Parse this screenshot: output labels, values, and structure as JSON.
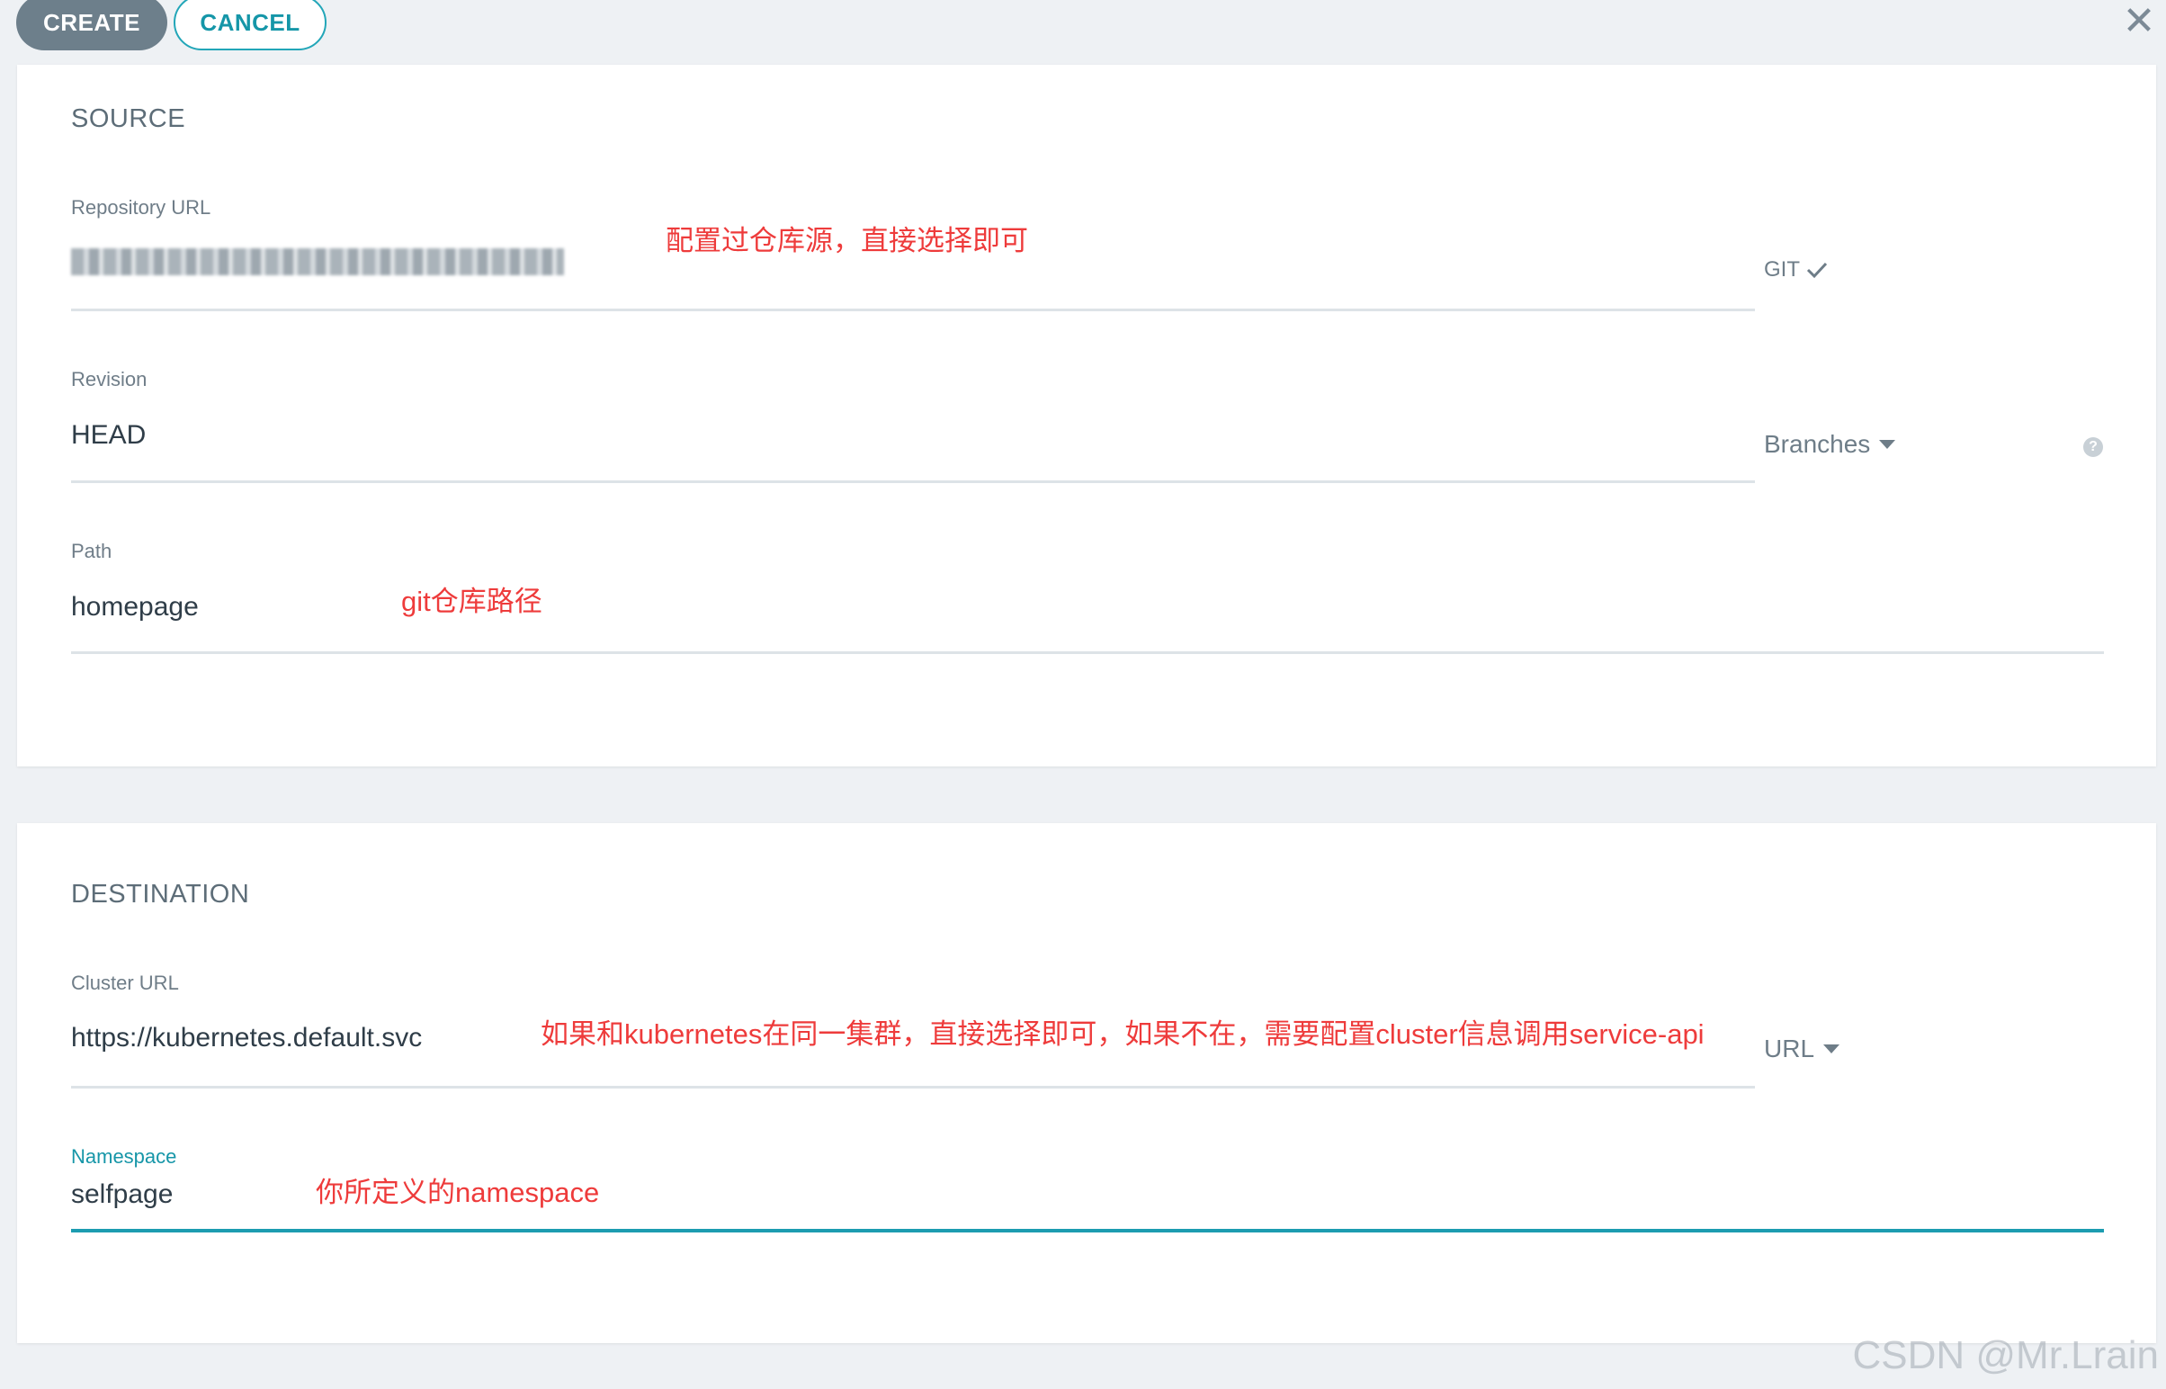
{
  "toolbar": {
    "create_label": "CREATE",
    "cancel_label": "CANCEL"
  },
  "source": {
    "title": "SOURCE",
    "repo_label": "Repository URL",
    "repo_type": "GIT",
    "revision_label": "Revision",
    "revision_value": "HEAD",
    "revision_dropdown": "Branches",
    "path_label": "Path",
    "path_value": "homepage"
  },
  "destination": {
    "title": "DESTINATION",
    "cluster_label": "Cluster URL",
    "cluster_value": "https://kubernetes.default.svc",
    "cluster_dropdown": "URL",
    "namespace_label": "Namespace",
    "namespace_value": "selfpage"
  },
  "annotations": {
    "repo": "配置过仓库源，直接选择即可",
    "path": "git仓库路径",
    "cluster": "如果和kubernetes在同一集群，直接选择即可，如果不在，需要配置cluster信息调用service-api",
    "namespace": "你所定义的namespace"
  },
  "watermark": "CSDN @Mr.Lrain",
  "colors": {
    "accent": "#1c9cb0",
    "annotation": "#ee3b3b",
    "create_button": "#6d7f8b"
  },
  "icons": {
    "close": "close-icon",
    "check": "check-icon",
    "help": "help-icon",
    "caret": "caret-down-icon"
  }
}
